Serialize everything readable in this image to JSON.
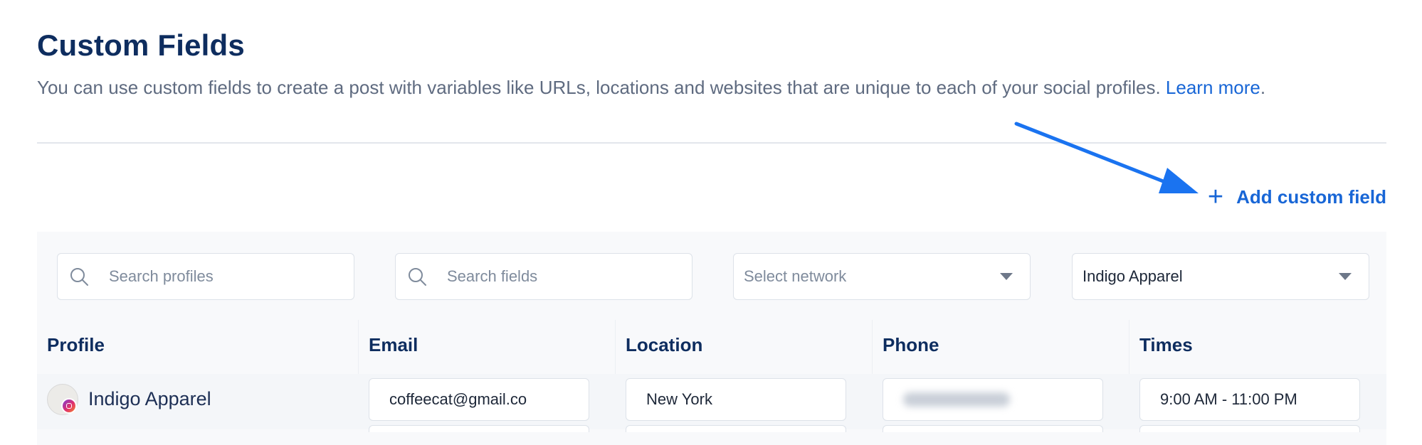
{
  "header": {
    "title": "Custom Fields",
    "description": "You can use custom fields to create a post with variables like URLs, locations and websites that are unique to each of your social profiles.",
    "learn_more": "Learn more",
    "period": "."
  },
  "actions": {
    "add_custom_field": "Add custom field"
  },
  "filters": {
    "search_profiles_placeholder": "Search profiles",
    "search_fields_placeholder": "Search fields",
    "network_placeholder": "Select network",
    "profile_group_value": "Indigo Apparel"
  },
  "table": {
    "columns": [
      "Profile",
      "Email",
      "Location",
      "Phone",
      "Times"
    ],
    "rows": [
      {
        "profile": "Indigo Apparel",
        "email": "coffeecat@gmail.co",
        "location": "New York",
        "phone": "",
        "times": "9:00 AM - 11:00 PM"
      }
    ]
  },
  "colors": {
    "accent": "#1866d6",
    "title": "#0e2d5f",
    "annotation_arrow": "#1a73f0"
  },
  "icons": [
    "search-icon",
    "chevron-down-icon",
    "plus-icon",
    "instagram-icon"
  ]
}
